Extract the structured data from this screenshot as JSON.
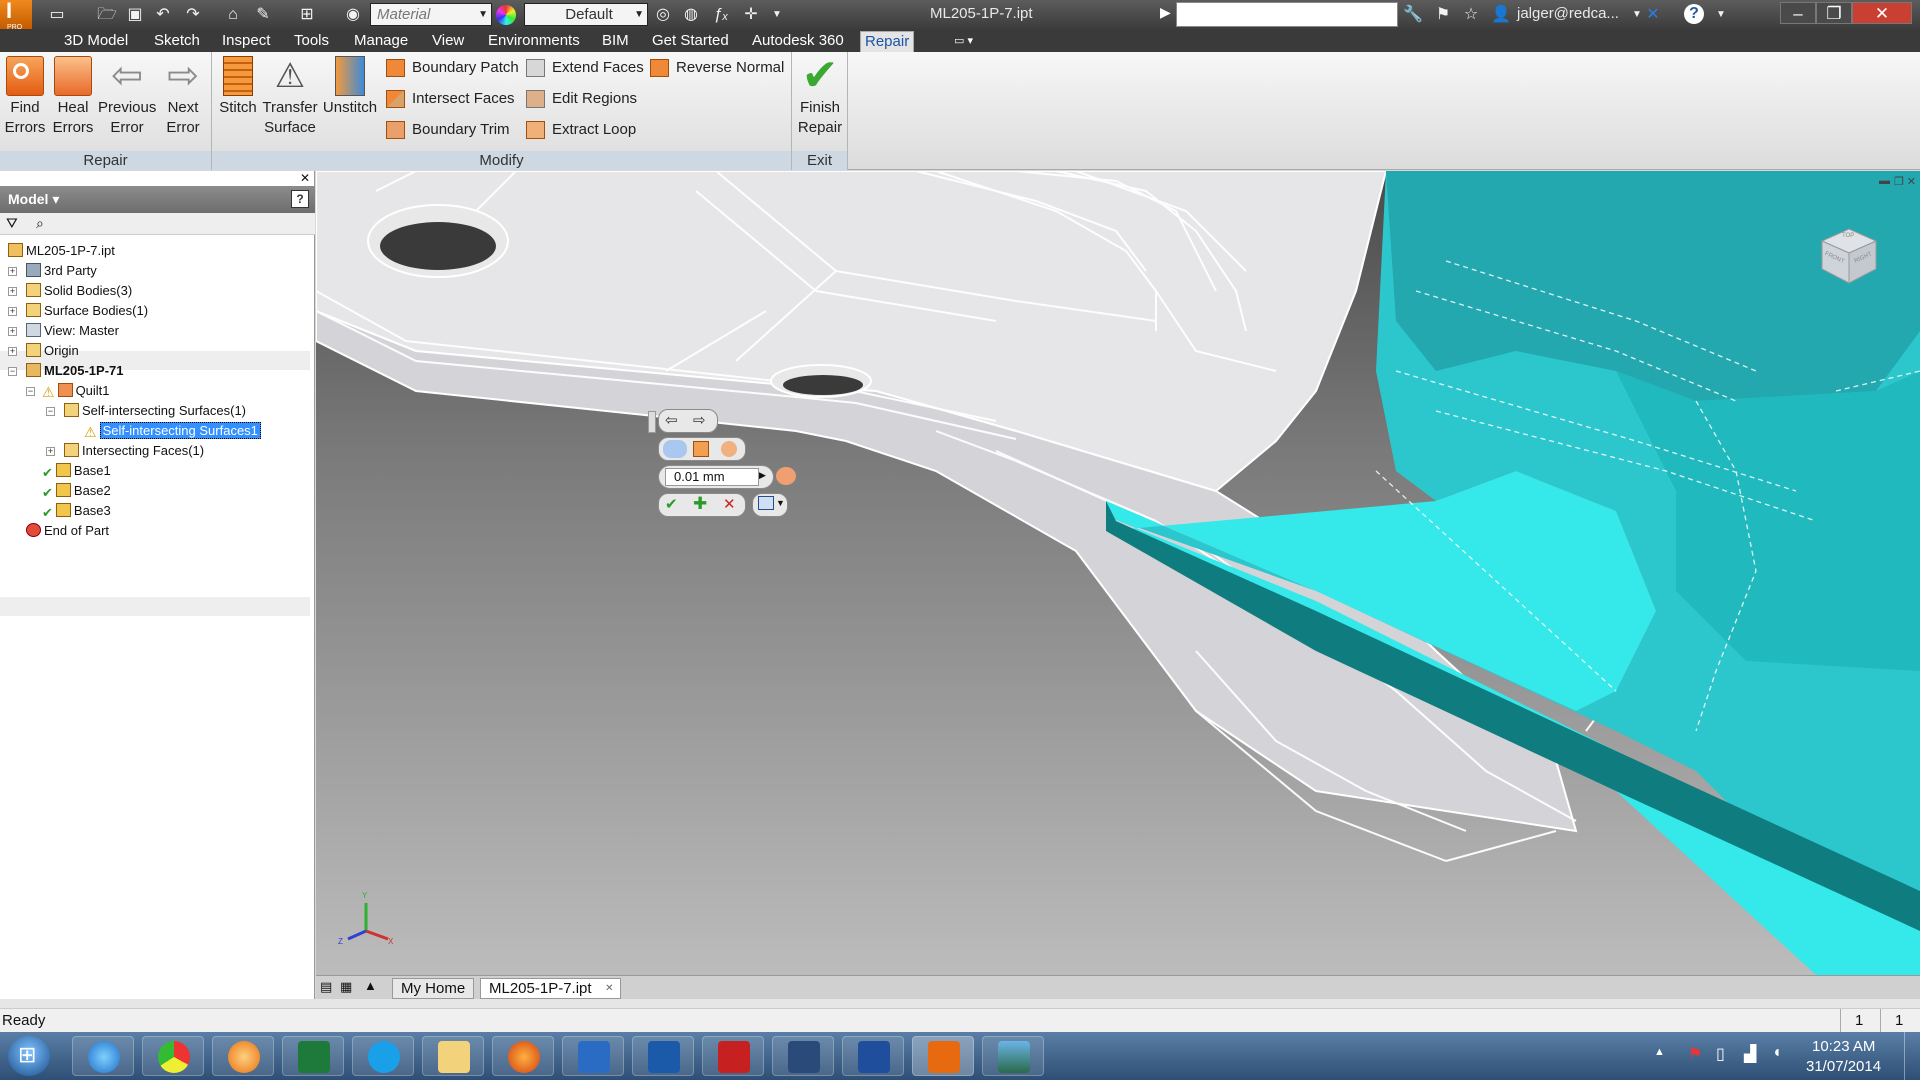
{
  "title_bar": {
    "app_badge": "PRO",
    "material_placeholder": "Material",
    "appearance_value": "Default",
    "document_title": "ML205-1P-7.ipt",
    "search_placeholder": "",
    "user_name": "jalger@redca...",
    "help": "?"
  },
  "menu": {
    "tabs": [
      "3D Model",
      "Sketch",
      "Inspect",
      "Tools",
      "Manage",
      "View",
      "Environments",
      "BIM",
      "Get Started",
      "Autodesk 360",
      "Repair"
    ],
    "active": "Repair"
  },
  "ribbon": {
    "repair_panel": {
      "label": "Repair",
      "buttons": [
        "Find\nErrors",
        "Heal\nErrors",
        "Previous\nError",
        "Next\nError"
      ]
    },
    "modify_panel": {
      "label": "Modify",
      "big_buttons": [
        "Stitch",
        "Transfer\nSurface",
        "Unstitch"
      ],
      "small_buttons": [
        "Boundary Patch",
        "Intersect Faces",
        "Boundary Trim",
        "Extend Faces",
        "Edit Regions",
        "Extract Loop",
        "Reverse Normal"
      ]
    },
    "exit_panel": {
      "label": "Exit",
      "button": "Finish\nRepair"
    }
  },
  "browser": {
    "header": "Model",
    "tree": [
      {
        "label": "ML205-1P-7.ipt",
        "level": 0
      },
      {
        "label": "3rd Party",
        "level": 1
      },
      {
        "label": "Solid Bodies(3)",
        "level": 1
      },
      {
        "label": "Surface Bodies(1)",
        "level": 1
      },
      {
        "label": "View: Master",
        "level": 1
      },
      {
        "label": "Origin",
        "level": 1
      },
      {
        "label": "ML205-1P-71",
        "level": 1
      },
      {
        "label": "Quilt1",
        "level": 2
      },
      {
        "label": "Self-intersecting Surfaces(1)",
        "level": 3
      },
      {
        "label": "Self-intersecting Surfaces1",
        "level": 4
      },
      {
        "label": "Intersecting Faces(1)",
        "level": 3
      },
      {
        "label": "Base1",
        "level": 2
      },
      {
        "label": "Base2",
        "level": 2
      },
      {
        "label": "Base3",
        "level": 2
      },
      {
        "label": "End of Part",
        "level": 1
      }
    ]
  },
  "viewport": {
    "mini_toolbar": {
      "tolerance": "0.01 mm"
    },
    "viewcube": {
      "top": "TOP",
      "front": "FRONT",
      "right": "RIGHT"
    },
    "axes": {
      "x": "X",
      "y": "Y",
      "z": "Z"
    }
  },
  "doc_tabs": [
    "My Home",
    "ML205-1P-7.ipt"
  ],
  "status": {
    "text": "Ready",
    "count1": "1",
    "count2": "1"
  },
  "taskbar": {
    "time": "10:23 AM",
    "date": "31/07/2014"
  },
  "colors": {
    "accent_blue": "#1c55a6",
    "surface_cyan": "#2ee6ea",
    "dark_cyan": "#0f7d80",
    "selection": "#3390ff"
  }
}
